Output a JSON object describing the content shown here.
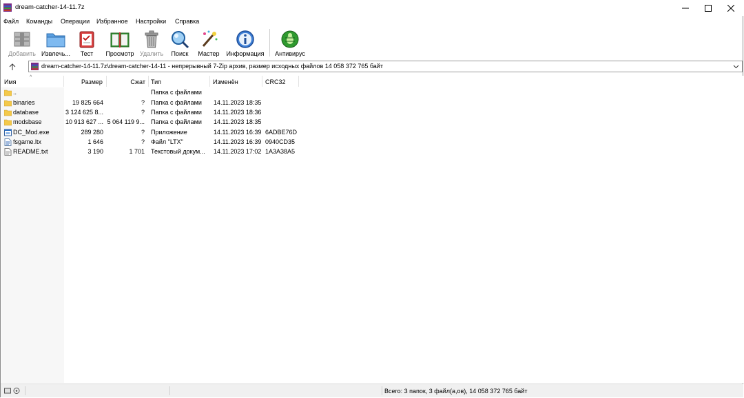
{
  "window": {
    "title": "dream-catcher-14-11.7z"
  },
  "menu": [
    "Файл",
    "Команды",
    "Операции",
    "Избранное",
    "Настройки",
    "Справка"
  ],
  "toolbar": [
    {
      "label": "Добавить",
      "icon": "add-archive-icon",
      "disabled": true
    },
    {
      "label": "Извлечь...",
      "icon": "extract-folder-icon",
      "disabled": false
    },
    {
      "label": "Тест",
      "icon": "test-clipboard-icon",
      "disabled": false
    },
    {
      "label": "Просмотр",
      "icon": "view-book-icon",
      "disabled": false
    },
    {
      "label": "Удалить",
      "icon": "delete-trash-icon",
      "disabled": true
    },
    {
      "label": "Поиск",
      "icon": "search-magnifier-icon",
      "disabled": false
    },
    {
      "label": "Мастер",
      "icon": "wizard-wand-icon",
      "disabled": false
    },
    {
      "label": "Информация",
      "icon": "info-icon",
      "disabled": false
    },
    {
      "label": "Антивирус",
      "icon": "antivirus-bug-icon",
      "disabled": false
    }
  ],
  "address": {
    "path": "dream-catcher-14-11.7z\\dream-catcher-14-11 - непрерывный 7-Zip архив, размер исходных файлов 14 058 372 765 байт"
  },
  "columns": {
    "name": "Имя",
    "size": "Размер",
    "packed": "Сжат",
    "type": "Тип",
    "modified": "Изменён",
    "crc": "CRC32"
  },
  "files": [
    {
      "name": "..",
      "size": "",
      "packed": "",
      "type": "Папка с файлами",
      "modified": "",
      "crc": "",
      "icon": "folder-icon"
    },
    {
      "name": "binaries",
      "size": "19 825 664",
      "packed": "?",
      "type": "Папка с файлами",
      "modified": "14.11.2023 18:35",
      "crc": "",
      "icon": "folder-icon"
    },
    {
      "name": "database",
      "size": "3 124 625 8...",
      "packed": "?",
      "type": "Папка с файлами",
      "modified": "14.11.2023 18:36",
      "crc": "",
      "icon": "folder-icon"
    },
    {
      "name": "modsbase",
      "size": "10 913 627 ...",
      "packed": "5 064 119 9...",
      "type": "Папка с файлами",
      "modified": "14.11.2023 18:35",
      "crc": "",
      "icon": "folder-icon"
    },
    {
      "name": "DC_Mod.exe",
      "size": "289 280",
      "packed": "?",
      "type": "Приложение",
      "modified": "14.11.2023 16:39",
      "crc": "6ADBE76D",
      "icon": "exe-icon"
    },
    {
      "name": "fsgame.ltx",
      "size": "1 646",
      "packed": "?",
      "type": "Файл \"LTX\"",
      "modified": "14.11.2023 16:39",
      "crc": "0940CD35",
      "icon": "ltx-file-icon"
    },
    {
      "name": "README.txt",
      "size": "3 190",
      "packed": "1 701",
      "type": "Текстовый докум...",
      "modified": "14.11.2023 17:02",
      "crc": "1A3A38A5",
      "icon": "text-file-icon"
    }
  ],
  "status": {
    "text": "Всего: 3 папок, 3 файл(а,ов), 14 058 372 765 байт"
  }
}
